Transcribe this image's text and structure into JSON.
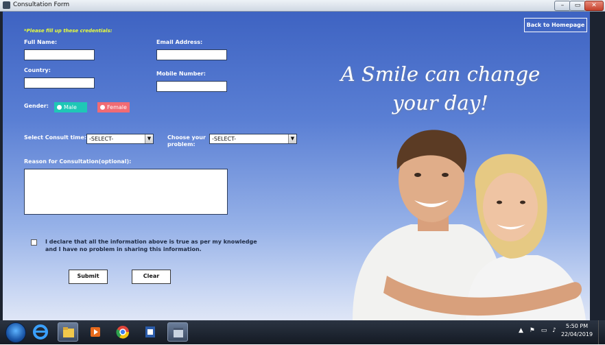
{
  "window": {
    "title": "Consultation Form",
    "minimize_icon": "minimize-icon",
    "maximize_icon": "maximize-icon",
    "close_icon": "close-icon",
    "min_glyph": "–",
    "max_glyph": "▭",
    "close_glyph": "✕"
  },
  "form": {
    "instruction": "*Please fill up these credentials:",
    "full_name_label": "Full Name:",
    "email_label": "Email Address:",
    "country_label": "Country:",
    "mobile_label": "Mobile Number:",
    "gender_label": "Gender:",
    "gender_options": [
      {
        "label": "Male",
        "color": "#1fc7b6"
      },
      {
        "label": "Female",
        "color": "#f06b74"
      }
    ],
    "consult_time_label": "Select Consult time:",
    "consult_time_value": "-SELECT-",
    "problem_label_line1": "Choose your",
    "problem_label_line2": "problem:",
    "problem_value": "-SELECT-",
    "reason_label": "Reason for Consultation(optional):",
    "declaration_line1": "I declare that all the information above is true as per my knowledge",
    "declaration_line2": "and I have no problem in sharing this information.",
    "submit_label": "Submit",
    "clear_label": "Clear",
    "home_button_label": "Back to Homepage"
  },
  "hero": {
    "tagline_line1": "A Smile can change",
    "tagline_line2": "your day!"
  },
  "colors": {
    "gradient_top": "#3e63c2",
    "gradient_bottom": "#dfe6f6",
    "instruction": "#e8ff3a"
  },
  "taskbar": {
    "icons": [
      "windows-start-icon",
      "internet-explorer-icon",
      "file-explorer-icon",
      "media-player-icon",
      "chrome-icon",
      "word-icon",
      "java-app-icon"
    ],
    "tray_icons": [
      "show-hidden-icon",
      "flag-icon",
      "network-icon",
      "volume-icon"
    ],
    "time": "5:50 PM",
    "date": "22/04/2019"
  }
}
